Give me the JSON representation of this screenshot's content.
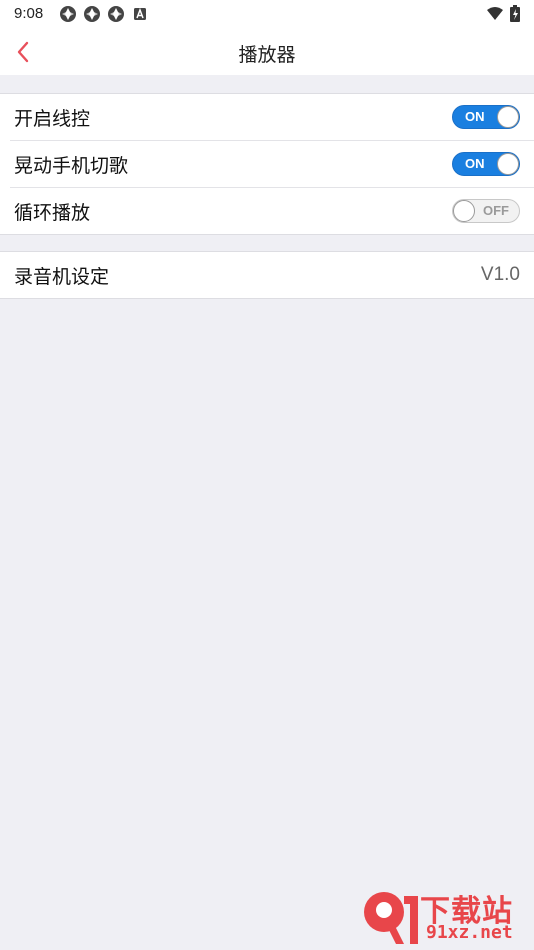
{
  "status_bar": {
    "time": "9:08",
    "icons_left": [
      "app-notification-icon",
      "app-notification-icon",
      "app-notification-icon",
      "a-notification-icon"
    ],
    "icons_right": [
      "wifi-icon",
      "battery-charging-icon"
    ]
  },
  "nav": {
    "title": "播放器",
    "back_icon": "chevron-left-icon",
    "accent_color": "#e8505b"
  },
  "settings_group_1": [
    {
      "label": "开启线控",
      "toggle": "ON",
      "state": true
    },
    {
      "label": "晃动手机切歌",
      "toggle": "ON",
      "state": true
    },
    {
      "label": "循环播放",
      "toggle": "OFF",
      "state": false
    }
  ],
  "settings_group_2": [
    {
      "label": "录音机设定",
      "value": "V1.0"
    }
  ],
  "watermark": {
    "cn": "下载站",
    "en": "91xz.net",
    "color": "#e8464a"
  },
  "colors": {
    "switch_on": "#1a7fe0",
    "background": "#efeff4"
  }
}
